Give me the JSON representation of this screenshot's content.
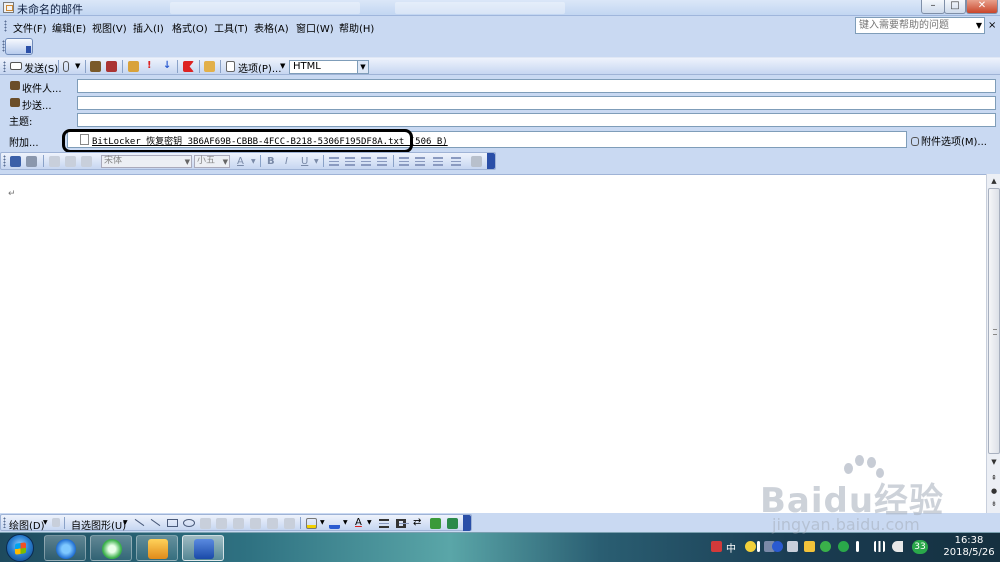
{
  "window": {
    "title": "未命名的邮件",
    "controls": {
      "minimize": "–",
      "maximize": "□",
      "close": "✕"
    }
  },
  "menu": {
    "items": [
      "文件(F)",
      "编辑(E)",
      "视图(V)",
      "插入(I)",
      "格式(O)",
      "工具(T)",
      "表格(A)",
      "窗口(W)",
      "帮助(H)"
    ],
    "help_placeholder": "键入需要帮助的问题",
    "doc_close": "×"
  },
  "envelope_toolbar": {
    "send_label": "发送(S)",
    "options_label": "选项(P)...",
    "format_value": "HTML"
  },
  "fields": {
    "to_label": "收件人...",
    "cc_label": "抄送...",
    "subject_label": "主题:",
    "attach_label": "附加...",
    "attachment_name": "BitLocker 恢复密钥 3B6AF69B-CBBB-4FCC-B218-5306F195DF8A.txt (506 B)",
    "attach_options_label": "附件选项(M)..."
  },
  "format_toolbar": {
    "font_value": "宋体",
    "size_value": "小五",
    "bold": "B",
    "italic": "I",
    "underline": "U",
    "font_color": "A"
  },
  "body": {
    "paragraph_mark": "↵"
  },
  "drawing_toolbar": {
    "draw_label": "绘图(D)",
    "autoshapes_label": "自选图形(U)"
  },
  "taskbar": {
    "input_lang": "中",
    "badge": "33",
    "time": "16:38",
    "date": "2018/5/26"
  },
  "watermark": {
    "brand": "Baidu经验",
    "url": "jingyan.baidu.com"
  },
  "colors": {
    "chrome": "#c9d9f2",
    "toolbar_accent": "#2a4fa8",
    "close_button": "#c9452a"
  }
}
